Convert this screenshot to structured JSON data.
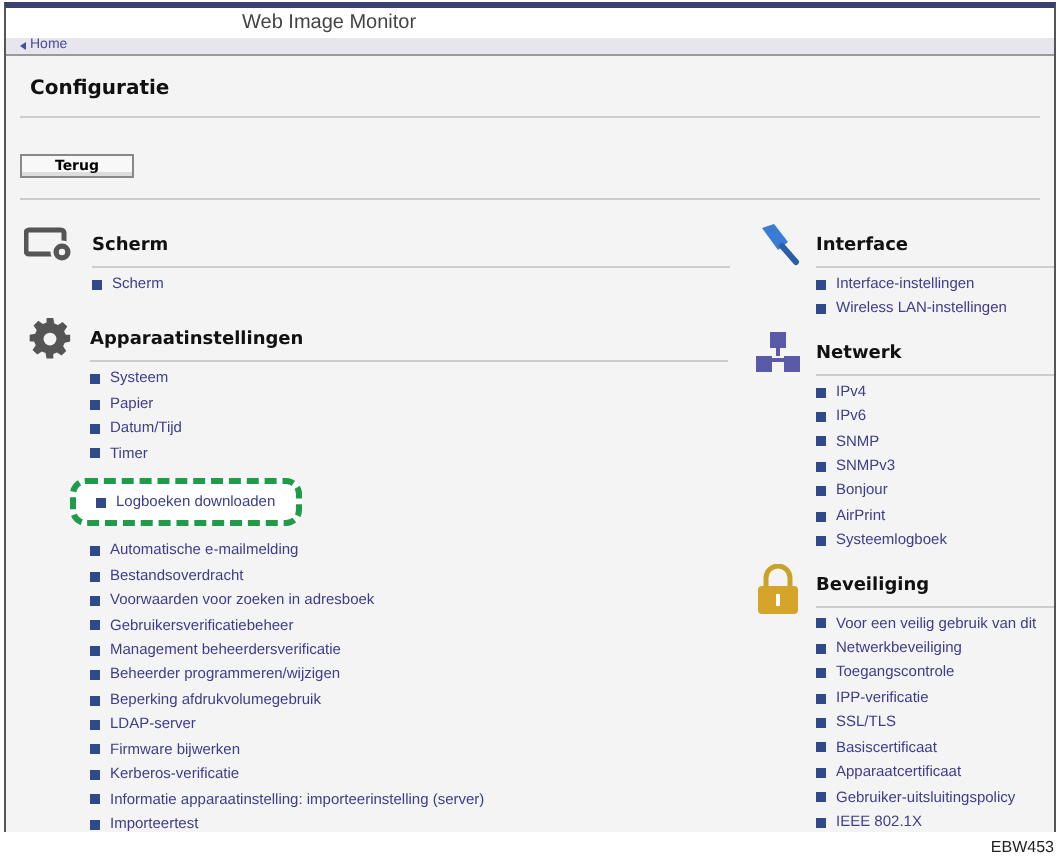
{
  "header": {
    "title": "Web Image Monitor"
  },
  "breadcrumb": {
    "label": "Home"
  },
  "page_title": "Configuratie",
  "back_button": "Terug",
  "left_sections": [
    {
      "kind": "display",
      "title": "Scherm",
      "items": [
        {
          "label": "Scherm",
          "highlighted": false
        }
      ]
    },
    {
      "kind": "device",
      "title": "Apparaatinstellingen",
      "items": [
        {
          "label": "Systeem",
          "highlighted": false
        },
        {
          "label": "Papier",
          "highlighted": false
        },
        {
          "label": "Datum/Tijd",
          "highlighted": false
        },
        {
          "label": "Timer",
          "highlighted": false
        },
        {
          "label": "Logboeken downloaden",
          "highlighted": true
        },
        {
          "label": "Automatische e-mailmelding",
          "highlighted": false
        },
        {
          "label": "Bestandsoverdracht",
          "highlighted": false
        },
        {
          "label": "Voorwaarden voor zoeken in adresboek",
          "highlighted": false
        },
        {
          "label": "Gebruikersverificatiebeheer",
          "highlighted": false
        },
        {
          "label": "Management beheerdersverificatie",
          "highlighted": false
        },
        {
          "label": "Beheerder programmeren/wijzigen",
          "highlighted": false
        },
        {
          "label": "Beperking afdrukvolumegebruik",
          "highlighted": false
        },
        {
          "label": "LDAP-server",
          "highlighted": false
        },
        {
          "label": "Firmware bijwerken",
          "highlighted": false
        },
        {
          "label": "Kerberos-verificatie",
          "highlighted": false
        },
        {
          "label": "Informatie apparaatinstelling: importeerinstelling (server)",
          "highlighted": false
        },
        {
          "label": "Importeertest",
          "highlighted": false
        }
      ]
    }
  ],
  "right_sections": [
    {
      "kind": "interface",
      "title": "Interface",
      "items": [
        {
          "label": "Interface-instellingen",
          "highlighted": false
        },
        {
          "label": "Wireless LAN-instellingen",
          "highlighted": false
        }
      ]
    },
    {
      "kind": "network",
      "title": "Netwerk",
      "items": [
        {
          "label": "IPv4",
          "highlighted": false
        },
        {
          "label": "IPv6",
          "highlighted": false
        },
        {
          "label": "SNMP",
          "highlighted": false
        },
        {
          "label": "SNMPv3",
          "highlighted": false
        },
        {
          "label": "Bonjour",
          "highlighted": false
        },
        {
          "label": "AirPrint",
          "highlighted": false
        },
        {
          "label": "Systeemlogboek",
          "highlighted": false
        }
      ]
    },
    {
      "kind": "security",
      "title": "Beveiliging",
      "items": [
        {
          "label": "Voor een veilig gebruik van dit",
          "highlighted": false
        },
        {
          "label": "Netwerkbeveiliging",
          "highlighted": false
        },
        {
          "label": "Toegangscontrole",
          "highlighted": false
        },
        {
          "label": "IPP-verificatie",
          "highlighted": false
        },
        {
          "label": "SSL/TLS",
          "highlighted": false
        },
        {
          "label": "Basiscertificaat",
          "highlighted": false
        },
        {
          "label": "Apparaatcertificaat",
          "highlighted": false
        },
        {
          "label": "Gebruiker-uitsluitingspolicy",
          "highlighted": false
        },
        {
          "label": "IEEE 802.1X",
          "highlighted": false
        }
      ]
    }
  ],
  "figure_code": "EBW453"
}
